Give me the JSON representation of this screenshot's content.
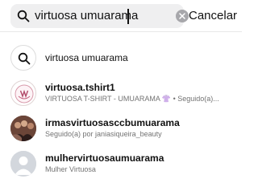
{
  "search": {
    "value": "virtuosa umuarama",
    "cancel_label": "Cancelar"
  },
  "results": [
    {
      "primary": "virtuosa umuarama",
      "type": "keyword"
    },
    {
      "primary": "virtuosa.tshirt1",
      "secondary": "VIRTUOSA T-SHIRT - UMUARAMA 👚 • Seguido(a)..."
    },
    {
      "primary": "irmasvirtuosasccbumuarama",
      "secondary": "Seguido(a) por janiasiqueira_beauty"
    },
    {
      "primary": "mulhervirtuosaumuarama",
      "secondary": "Mulher Virtuosa"
    }
  ]
}
